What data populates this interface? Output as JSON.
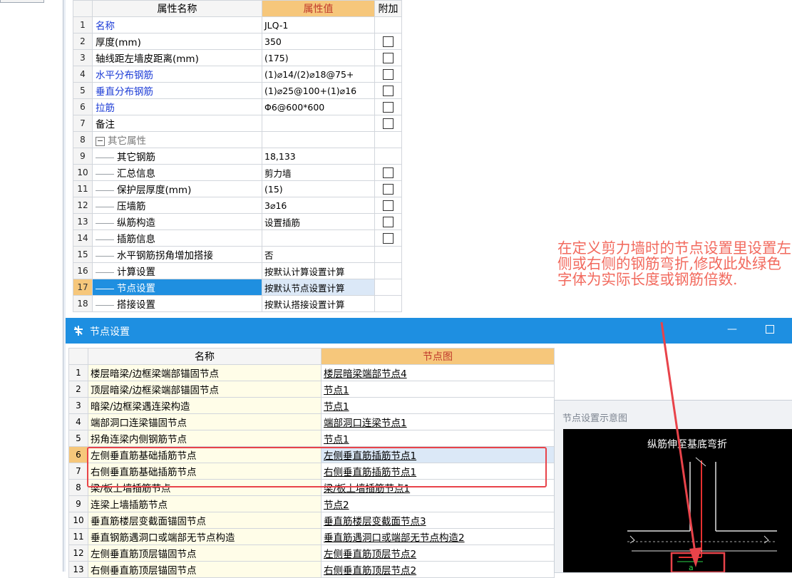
{
  "properties": {
    "headers": {
      "name": "属性名称",
      "value": "属性值",
      "extra": "附加"
    },
    "rows": [
      {
        "num": "1",
        "name": "名称",
        "value": "JLQ-1",
        "style": "blue",
        "check": false
      },
      {
        "num": "2",
        "name": "厚度(mm)",
        "value": "350",
        "style": "normal",
        "check": true
      },
      {
        "num": "3",
        "name": "轴线距左墙皮距离(mm)",
        "value": "(175)",
        "style": "normal",
        "check": true
      },
      {
        "num": "4",
        "name": "水平分布钢筋",
        "value": "(1)⌀14/(2)⌀18@75+",
        "style": "blue",
        "check": true
      },
      {
        "num": "5",
        "name": "垂直分布钢筋",
        "value": "(1)⌀25@100+(1)⌀16",
        "style": "blue",
        "check": true
      },
      {
        "num": "6",
        "name": "拉筋",
        "value": "Φ6@600*600",
        "style": "blue",
        "check": true
      },
      {
        "num": "7",
        "name": "备注",
        "value": "",
        "style": "normal",
        "check": true
      },
      {
        "num": "8",
        "name": "其它属性",
        "value": "",
        "style": "group",
        "check": false
      },
      {
        "num": "9",
        "name": "其它钢筋",
        "value": "18,133",
        "style": "child",
        "check": false
      },
      {
        "num": "10",
        "name": "汇总信息",
        "value": "剪力墙",
        "style": "child",
        "check": true
      },
      {
        "num": "11",
        "name": "保护层厚度(mm)",
        "value": "(15)",
        "style": "child",
        "check": true
      },
      {
        "num": "12",
        "name": "压墙筋",
        "value": "3⌀16",
        "style": "child",
        "check": true
      },
      {
        "num": "13",
        "name": "纵筋构造",
        "value": "设置插筋",
        "style": "child",
        "check": true
      },
      {
        "num": "14",
        "name": "插筋信息",
        "value": "",
        "style": "child",
        "check": true
      },
      {
        "num": "15",
        "name": "水平钢筋拐角增加搭接",
        "value": "否",
        "style": "child",
        "check": false
      },
      {
        "num": "16",
        "name": "计算设置",
        "value": "按默认计算设置计算",
        "style": "child",
        "check": false
      },
      {
        "num": "17",
        "name": "节点设置",
        "value": "按默认节点设置计算",
        "style": "selected",
        "check": false
      },
      {
        "num": "18",
        "name": "搭接设置",
        "value": "按默认搭接设置计算",
        "style": "child",
        "check": false
      }
    ]
  },
  "annotation": {
    "text": "在定义剪力墙时的节点设置里设置左侧或右侧的钢筋弯折,修改此处绿色字体为实际长度或钢筋倍数."
  },
  "dialog": {
    "title": "节点设置",
    "headers": {
      "name": "名称",
      "node": "节点图"
    },
    "rows": [
      {
        "num": "1",
        "name": "楼层暗梁/边框梁端部锚固节点",
        "node": "楼层暗梁端部节点4"
      },
      {
        "num": "2",
        "name": "顶层暗梁/边框梁端部锚固节点",
        "node": "节点1"
      },
      {
        "num": "3",
        "name": "暗梁/边框梁遇连梁构造",
        "node": "节点1"
      },
      {
        "num": "4",
        "name": "端部洞口连梁锚固节点",
        "node": "端部洞口连梁节点1"
      },
      {
        "num": "5",
        "name": "拐角连梁内侧钢筋节点",
        "node": "节点1"
      },
      {
        "num": "6",
        "name": "左侧垂直筋基础插筋节点",
        "node": "左侧垂直筋插筋节点1"
      },
      {
        "num": "7",
        "name": "右侧垂直筋基础插筋节点",
        "node": "右侧垂直筋插筋节点1"
      },
      {
        "num": "8",
        "name": "梁/板上墙插筋节点",
        "node": "梁/板上墙插筋节点1"
      },
      {
        "num": "9",
        "name": "连梁上墙插筋节点",
        "node": "节点2"
      },
      {
        "num": "10",
        "name": "垂直筋楼层变截面锚固节点",
        "node": "垂直筋楼层变截面节点3"
      },
      {
        "num": "11",
        "name": "垂直钢筋遇洞口或端部无节点构造",
        "node": "垂直筋遇洞口或端部无节点构造2"
      },
      {
        "num": "12",
        "name": "左侧垂直筋顶层锚固节点",
        "node": "左侧垂直筋顶层节点2"
      },
      {
        "num": "13",
        "name": "右侧垂直筋顶层锚固节点",
        "node": "右侧垂直筋顶层节点2"
      }
    ],
    "preview": {
      "label": "节点设置示意图",
      "caption": "纵筋伸至基底弯折",
      "dim": "a"
    }
  },
  "colors": {
    "accent": "#1e8fe1",
    "header_value": "#f6c77b",
    "annotation": "#f26a5e",
    "highlight_box": "#e8434a",
    "link_text": "#1b3bd6"
  }
}
